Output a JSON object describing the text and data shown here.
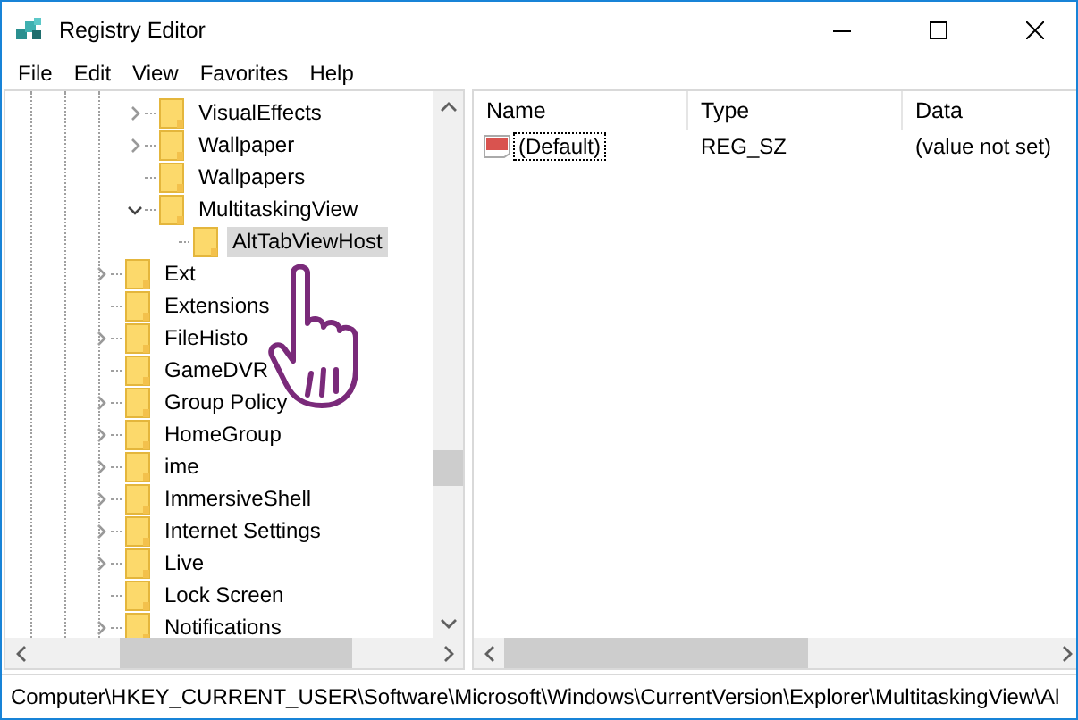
{
  "window": {
    "title": "Registry Editor"
  },
  "menu": [
    {
      "label": "File"
    },
    {
      "label": "Edit"
    },
    {
      "label": "View"
    },
    {
      "label": "Favorites"
    },
    {
      "label": "Help"
    }
  ],
  "tree": {
    "items": [
      {
        "children": [
          {
            "label": "VisualEffects",
            "kind": "collapsed",
            "selected": false
          },
          {
            "label": "Wallpaper",
            "kind": "collapsed",
            "selected": false
          },
          {
            "label": "Wallpapers",
            "kind": "leaf",
            "selected": false
          },
          {
            "label": "MultitaskingView",
            "kind": "expanded",
            "selected": false,
            "children": [
              {
                "label": "AltTabViewHost",
                "kind": "leaf",
                "selected": true
              }
            ]
          }
        ]
      },
      {
        "label": "Ext",
        "kind": "collapsed",
        "selected": false
      },
      {
        "label": "Extensions",
        "kind": "leaf",
        "selected": false
      },
      {
        "label": "FileHisto",
        "kind": "collapsed",
        "selected": false
      },
      {
        "label": "GameDVR",
        "kind": "leaf",
        "selected": false
      },
      {
        "label": "Group Policy",
        "kind": "collapsed",
        "selected": false
      },
      {
        "label": "HomeGroup",
        "kind": "collapsed",
        "selected": false
      },
      {
        "label": "ime",
        "kind": "collapsed",
        "selected": false
      },
      {
        "label": "ImmersiveShell",
        "kind": "collapsed",
        "selected": false
      },
      {
        "label": "Internet Settings",
        "kind": "collapsed",
        "selected": false
      },
      {
        "label": "Live",
        "kind": "collapsed",
        "selected": false
      },
      {
        "label": "Lock Screen",
        "kind": "leaf",
        "selected": false
      },
      {
        "label": "Notifications",
        "kind": "collapsed",
        "selected": false
      }
    ]
  },
  "values": {
    "columns": [
      "Name",
      "Type",
      "Data"
    ],
    "rows": [
      {
        "name": "(Default)",
        "type": "REG_SZ",
        "data": "(value not set)",
        "selected": true
      }
    ]
  },
  "status_bar": "Computer\\HKEY_CURRENT_USER\\Software\\Microsoft\\Windows\\CurrentVersion\\Explorer\\MultitaskingView\\Al"
}
